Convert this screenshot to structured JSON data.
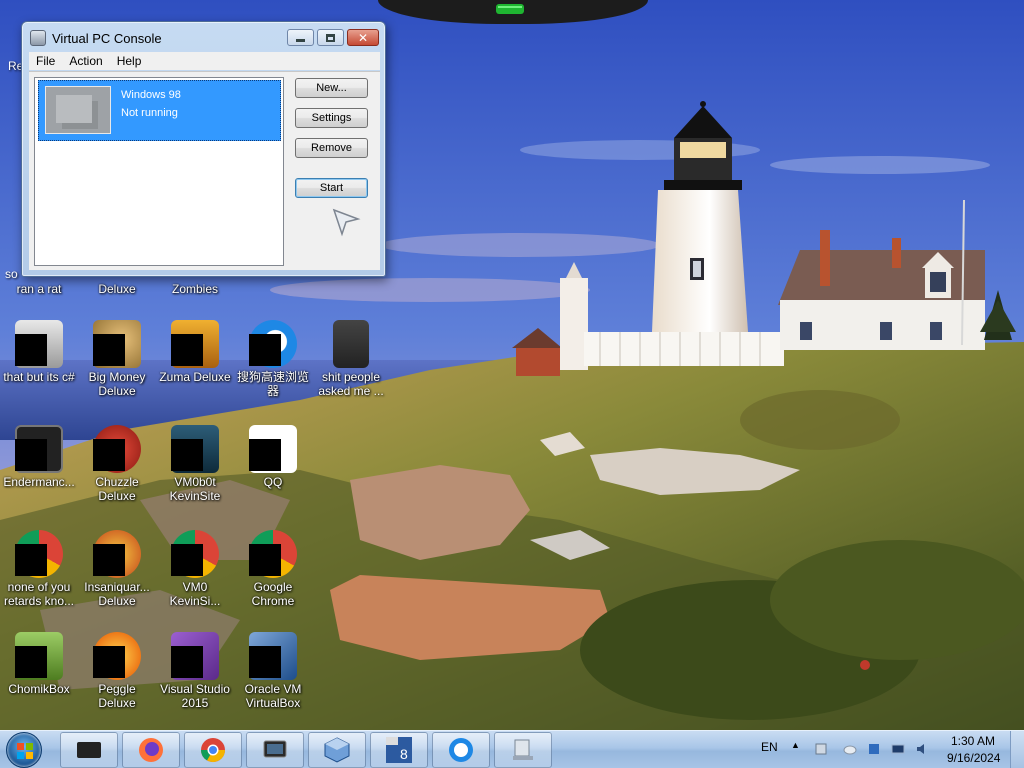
{
  "window": {
    "title": "Virtual PC Console",
    "menu": [
      "File",
      "Action",
      "Help"
    ],
    "vm": {
      "name": "Windows 98",
      "status": "Not running"
    },
    "buttons": {
      "new": "New...",
      "settings": "Settings",
      "remove": "Remove",
      "start": "Start"
    }
  },
  "desktop": {
    "partial_labels": {
      "top_left": "Re",
      "left_edge": "so",
      "row0_col0": "ran a rat",
      "row0_col1": "Deluxe",
      "row0_col2": "Zombies"
    },
    "icons": [
      {
        "label": "that but its c#",
        "icon": "layered-windows-icon"
      },
      {
        "label": "Big Money Deluxe",
        "icon": "money-bag-icon"
      },
      {
        "label": "Zuma Deluxe",
        "icon": "zuma-frog-icon"
      },
      {
        "label": "搜狗高速浏览器",
        "icon": "sogou-browser-icon"
      },
      {
        "label": "shit people asked me ...",
        "icon": "folder-icon"
      },
      {
        "label": "Endermanc...",
        "icon": "terminal-icon"
      },
      {
        "label": "Chuzzle Deluxe",
        "icon": "chuzzle-icon"
      },
      {
        "label": "VM0b0t KevinSite",
        "icon": "vm-icon"
      },
      {
        "label": "QQ",
        "icon": "qq-penguin-icon"
      },
      {
        "label": "none of you retards kno...",
        "icon": "chrome-icon"
      },
      {
        "label": "Insaniquar... Deluxe",
        "icon": "insaniquarium-icon"
      },
      {
        "label": "VM0 KevinSi...",
        "icon": "chrome-icon"
      },
      {
        "label": "Google Chrome",
        "icon": "chrome-icon"
      },
      {
        "label": "ChomikBox",
        "icon": "chomikbox-icon"
      },
      {
        "label": "Peggle Deluxe",
        "icon": "peggle-icon"
      },
      {
        "label": "Visual Studio 2015",
        "icon": "visual-studio-icon"
      },
      {
        "label": "Oracle VM VirtualBox",
        "icon": "virtualbox-icon"
      }
    ]
  },
  "taskbar": {
    "apps": [
      "vm-app-icon",
      "firefox-icon",
      "chrome-icon",
      "virtual-pc-icon",
      "virtualbox-icon",
      "win8-64-icon",
      "sogou-icon",
      "computer-icon"
    ],
    "language": "EN",
    "time": "1:30 AM",
    "date": "9/16/2024"
  },
  "colors": {
    "selection": "#3399ff",
    "sky": "#4a6fd0",
    "taskbar": "#a9c6e8"
  }
}
